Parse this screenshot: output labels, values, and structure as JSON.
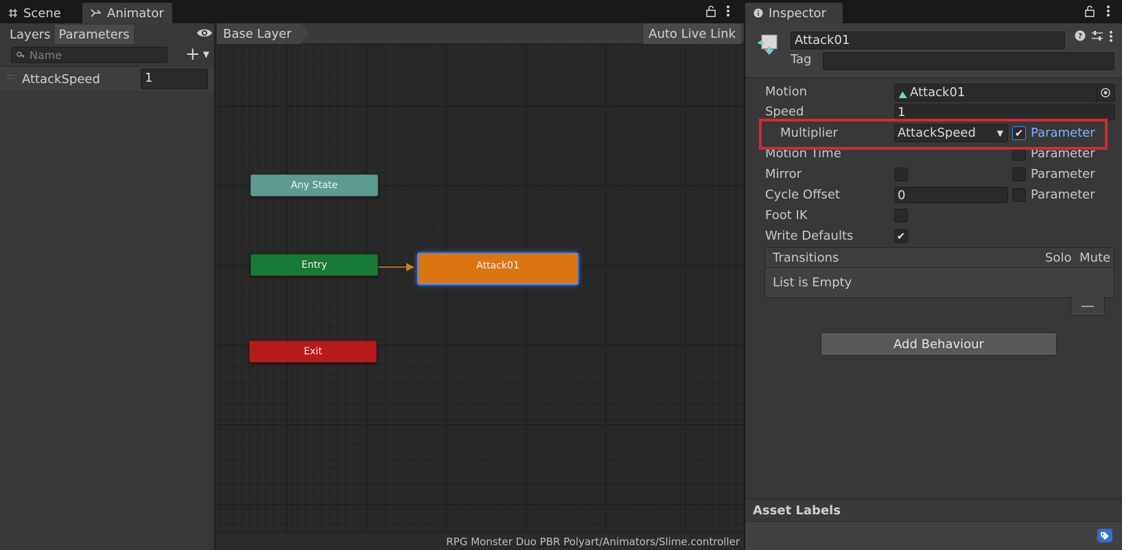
{
  "tabs": {
    "scene": "Scene",
    "animator": "Animator",
    "inspector": "Inspector"
  },
  "params_panel": {
    "tab_layers": "Layers",
    "tab_parameters": "Parameters",
    "search_placeholder": "Name",
    "parameters": [
      {
        "name": "AttackSpeed",
        "value": "1"
      }
    ]
  },
  "graph": {
    "breadcrumb": "Base Layer",
    "auto_live_link": "Auto Live Link",
    "nodes": {
      "any_state": "Any State",
      "entry": "Entry",
      "attack": "Attack01",
      "exit": "Exit"
    },
    "status_path": "RPG Monster Duo PBR Polyart/Animators/Slime.controller"
  },
  "inspector": {
    "state_name": "Attack01",
    "tag_label": "Tag",
    "tag_value": "",
    "motion_label": "Motion",
    "motion_value": "Attack01",
    "speed_label": "Speed",
    "speed_value": "1",
    "multiplier_label": "Multiplier",
    "multiplier_value": "AttackSpeed",
    "multiplier_parameter_checked": true,
    "parameter_label": "Parameter",
    "motion_time_label": "Motion Time",
    "mirror_label": "Mirror",
    "cycle_offset_label": "Cycle Offset",
    "cycle_offset_value": "0",
    "foot_ik_label": "Foot IK",
    "write_defaults_label": "Write Defaults",
    "write_defaults_checked": true,
    "transitions_label": "Transitions",
    "solo_label": "Solo",
    "mute_label": "Mute",
    "list_empty": "List is Empty",
    "add_behaviour": "Add Behaviour",
    "asset_labels": "Asset Labels"
  },
  "colors": {
    "any_state_node": "#5d9b92",
    "entry_node": "#177a35",
    "attack_node": "#db7510",
    "exit_node": "#b81a1a",
    "highlight": "#e2232d",
    "parameter_active": "#7fb1ff",
    "selection_glow": "#3d8cff"
  }
}
